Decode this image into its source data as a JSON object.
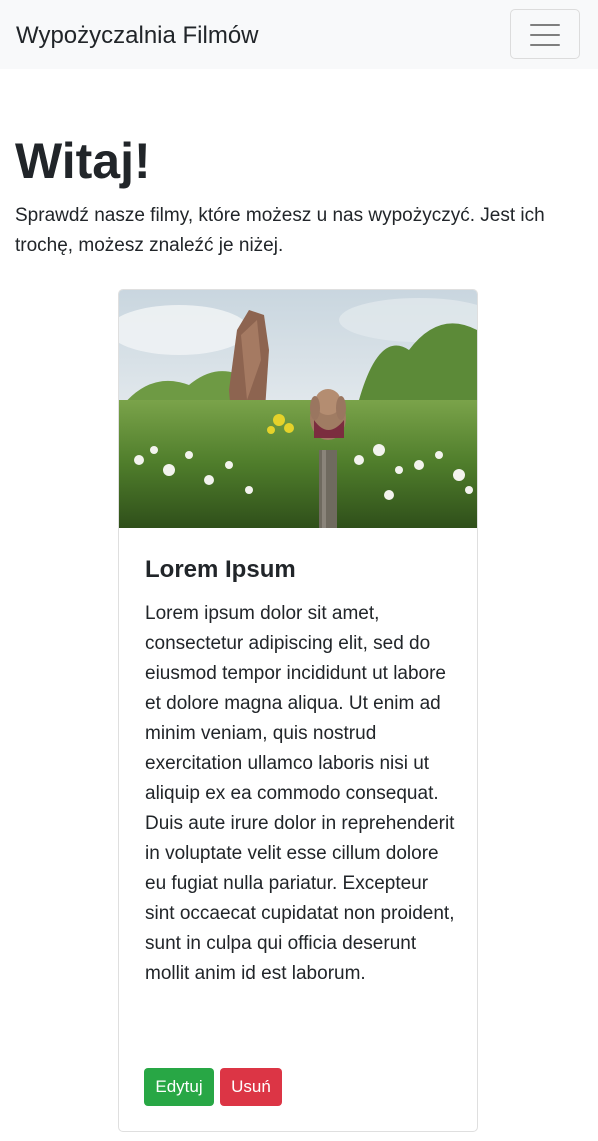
{
  "navbar": {
    "brand": "Wypożyczalnia Filmów",
    "toggler_icon": "hamburger-menu-icon",
    "background": "#f8f9fa"
  },
  "hero": {
    "title": "Witaj!",
    "lead": "Sprawdź nasze filmy, które możesz u nas wypożyczyć. Jest ich trochę, możesz znaleźć je niżej."
  },
  "movies": [
    {
      "image": "photo of a plush toy on a wooden post in a field of wildflowers",
      "title": "Lorem Ipsum",
      "description": "Lorem ipsum dolor sit amet, consectetur adipiscing elit, sed do eiusmod tempor incididunt ut labore et dolore magna aliqua. Ut enim ad minim veniam, quis nostrud exercitation ullamco laboris nisi ut aliquip ex ea commodo consequat. Duis aute irure dolor in reprehenderit in voluptate velit esse cillum dolore eu fugiat nulla pariatur. Excepteur sint occaecat cupidatat non proident, sunt in culpa qui officia deserunt mollit anim id est laborum.",
      "edit_label": "Edytuj",
      "delete_label": "Usuń"
    }
  ],
  "colors": {
    "edit_button": "#28a745",
    "delete_button": "#dc3545",
    "text": "#212529"
  }
}
